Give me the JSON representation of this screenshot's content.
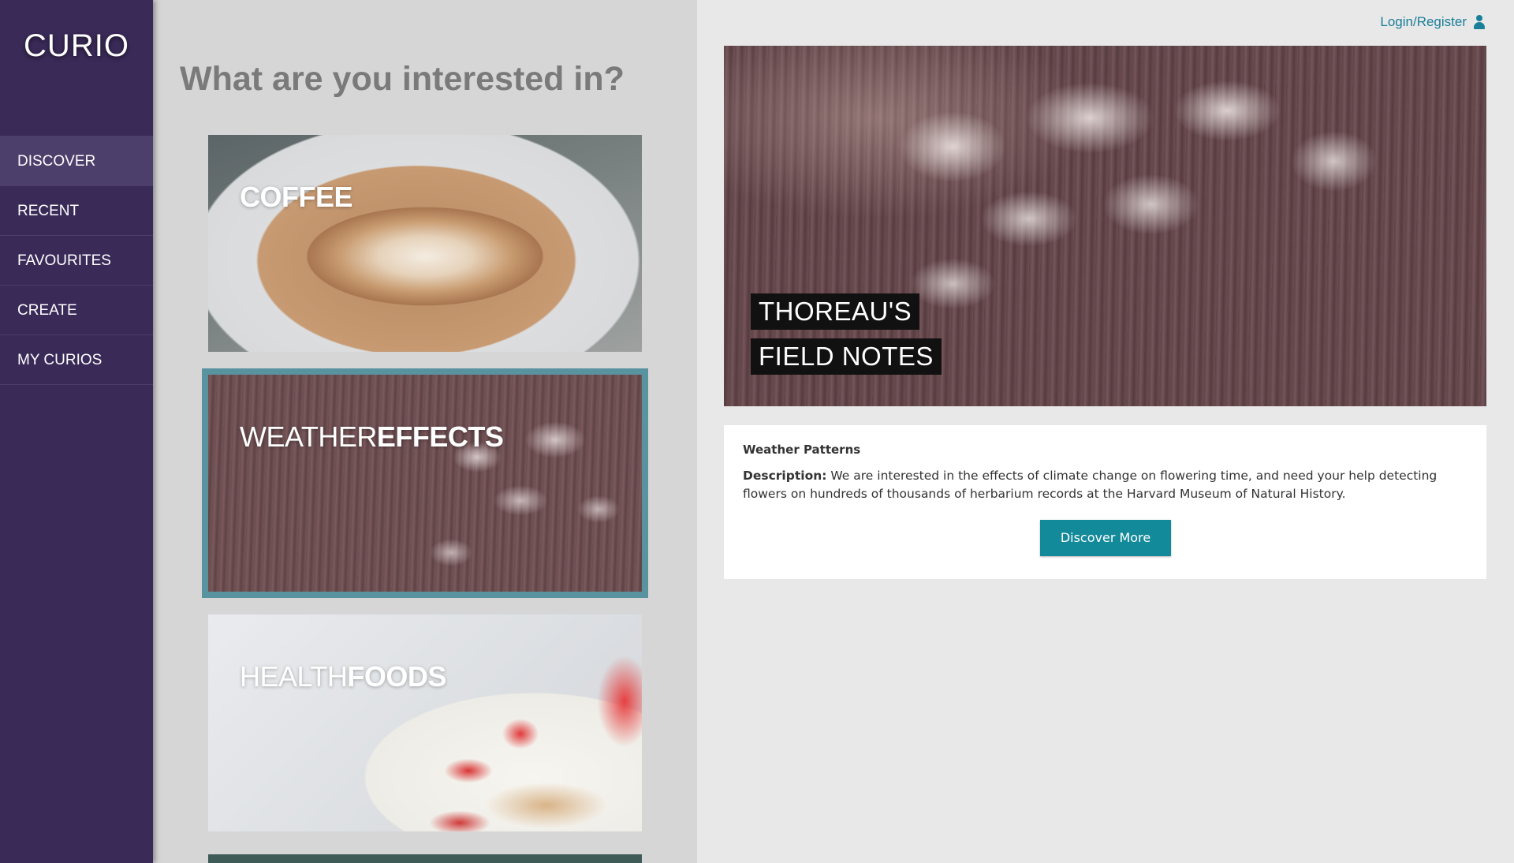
{
  "app": {
    "logo": "CURIO"
  },
  "sidebar": {
    "items": [
      {
        "label": "DISCOVER",
        "active": true
      },
      {
        "label": "RECENT"
      },
      {
        "label": "FAVOURITES"
      },
      {
        "label": "CREATE"
      },
      {
        "label": "MY CURIOS"
      }
    ]
  },
  "main": {
    "headline": "What are you interested in?",
    "cards": [
      {
        "light": "",
        "bold": "COFFEE"
      },
      {
        "light": "WEATHER",
        "bold": "EFFECTS",
        "selected": true
      },
      {
        "light": "HEALTH",
        "bold": "FOODS"
      }
    ]
  },
  "header": {
    "login_label": "Login/Register",
    "login_icon": "user-icon"
  },
  "detail": {
    "hero_line1": "THOREAU'S",
    "hero_line2": "FIELD NOTES",
    "title": "Weather Patterns",
    "description_label": "Description:",
    "description_text": "We are interested in the effects of climate change on flowering time, and need your help detecting flowers on hundreds of thousands of herbarium records at the Harvard Museum of Natural History.",
    "button_label": "Discover More"
  },
  "colors": {
    "sidebar": "#3a2a58",
    "accent": "#138a9a",
    "selected_outline": "#5a93a0"
  }
}
